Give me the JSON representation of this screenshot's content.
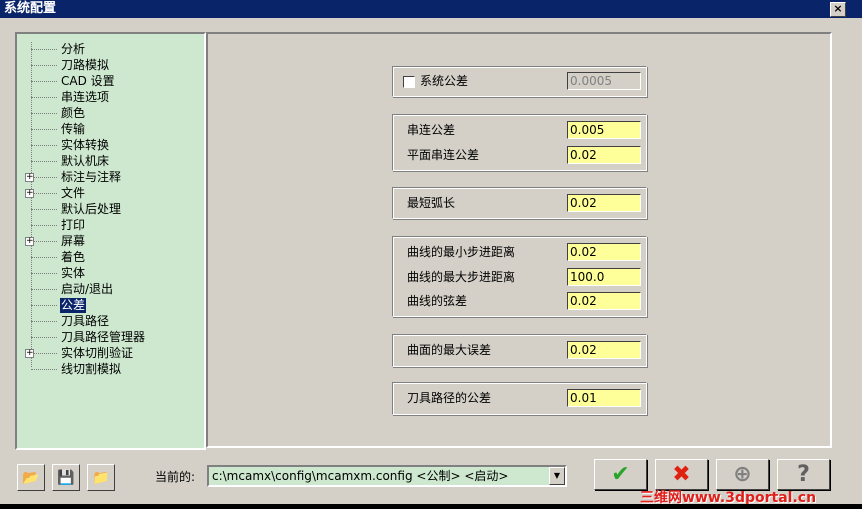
{
  "window": {
    "title": "系统配置",
    "close": "×"
  },
  "tree": {
    "items": [
      {
        "label": "分析",
        "expandable": false
      },
      {
        "label": "刀路模拟",
        "expandable": false
      },
      {
        "label": "CAD 设置",
        "expandable": false
      },
      {
        "label": "串连选项",
        "expandable": false
      },
      {
        "label": "颜色",
        "expandable": false
      },
      {
        "label": "传输",
        "expandable": false
      },
      {
        "label": "实体转换",
        "expandable": false
      },
      {
        "label": "默认机床",
        "expandable": false
      },
      {
        "label": "标注与注释",
        "expandable": true
      },
      {
        "label": "文件",
        "expandable": true
      },
      {
        "label": "默认后处理",
        "expandable": false
      },
      {
        "label": "打印",
        "expandable": false
      },
      {
        "label": "屏幕",
        "expandable": true
      },
      {
        "label": "着色",
        "expandable": false
      },
      {
        "label": "实体",
        "expandable": false
      },
      {
        "label": "启动/退出",
        "expandable": false
      },
      {
        "label": "公差",
        "expandable": false,
        "selected": true
      },
      {
        "label": "刀具路径",
        "expandable": false
      },
      {
        "label": "刀具路径管理器",
        "expandable": false
      },
      {
        "label": "实体切削验证",
        "expandable": true
      },
      {
        "label": "线切割模拟",
        "expandable": false
      }
    ]
  },
  "tolerance": {
    "system": {
      "label": "系统公差",
      "checked": false,
      "value": "0.0005"
    },
    "chain": {
      "label": "串连公差",
      "value": "0.005"
    },
    "planar_chain": {
      "label": "平面串连公差",
      "value": "0.02"
    },
    "min_arc": {
      "label": "最短弧长",
      "value": "0.02"
    },
    "curve_min_step": {
      "label": "曲线的最小步进距离",
      "value": "0.02"
    },
    "curve_max_step": {
      "label": "曲线的最大步进距离",
      "value": "100.0"
    },
    "curve_chord": {
      "label": "曲线的弦差",
      "value": "0.02"
    },
    "surface_max_dev": {
      "label": "曲面的最大误差",
      "value": "0.02"
    },
    "toolpath_tol": {
      "label": "刀具路径的公差",
      "value": "0.01"
    }
  },
  "footer": {
    "current_label": "当前的:",
    "config": "c:\\mcamx\\config\\mcamxm.config <公制> <启动>"
  },
  "watermark": "三维网www.3dportal.cn"
}
